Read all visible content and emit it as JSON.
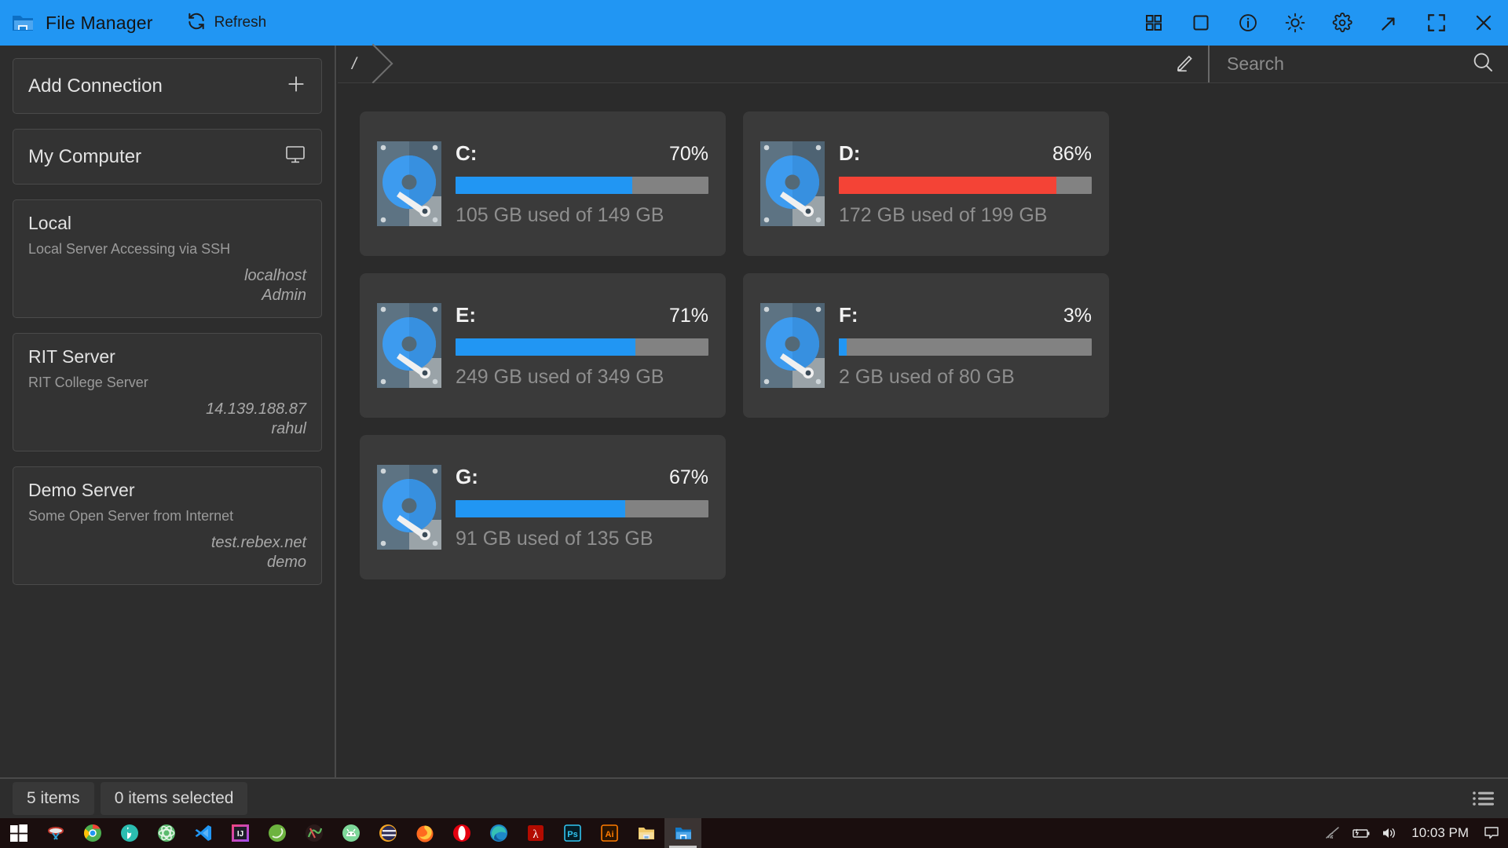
{
  "window": {
    "title": "File Manager",
    "app_icon": "folder-app-icon",
    "refresh_label": "Refresh",
    "accent_color": "#2196f3",
    "controls": [
      {
        "name": "grid-view-icon",
        "label": "Grid View"
      },
      {
        "name": "square-icon",
        "label": "Window"
      },
      {
        "name": "info-icon",
        "label": "Info"
      },
      {
        "name": "brightness-icon",
        "label": "Theme"
      },
      {
        "name": "gear-icon",
        "label": "Settings"
      },
      {
        "name": "minimize-icon",
        "label": "Restore Down"
      },
      {
        "name": "fullscreen-icon",
        "label": "Maximize"
      },
      {
        "name": "close-icon",
        "label": "Close"
      }
    ]
  },
  "sidebar": {
    "add_connection": {
      "label": "Add Connection",
      "icon": "plus-icon"
    },
    "my_computer": {
      "label": "My Computer",
      "icon": "monitor-icon"
    },
    "connections": [
      {
        "name": "Local",
        "description": "Local Server Accessing via SSH",
        "host": "localhost",
        "user": "Admin"
      },
      {
        "name": "RIT Server",
        "description": "RIT College Server",
        "host": "14.139.188.87",
        "user": "rahul"
      },
      {
        "name": "Demo Server",
        "description": "Some Open Server from Internet",
        "host": "test.rebex.net",
        "user": "demo"
      }
    ]
  },
  "pathbar": {
    "breadcrumbs": [
      "/"
    ],
    "edit_icon": "pencil-icon",
    "search": {
      "placeholder": "Search",
      "value": "",
      "icon": "search-icon"
    }
  },
  "drives": [
    {
      "letter": "C:",
      "percent": "70%",
      "fill": 70,
      "usage": "105 GB used of 149 GB",
      "color": "#2196f3",
      "icon": "hard-disk-icon"
    },
    {
      "letter": "D:",
      "percent": "86%",
      "fill": 86,
      "usage": "172 GB used of 199 GB",
      "color": "#f44336",
      "icon": "hard-disk-icon"
    },
    {
      "letter": "E:",
      "percent": "71%",
      "fill": 71,
      "usage": "249 GB used of 349 GB",
      "color": "#2196f3",
      "icon": "hard-disk-icon"
    },
    {
      "letter": "F:",
      "percent": "3%",
      "fill": 3,
      "usage": "2 GB used of 80 GB",
      "color": "#2196f3",
      "icon": "hard-disk-icon"
    },
    {
      "letter": "G:",
      "percent": "67%",
      "fill": 67,
      "usage": "91 GB used of 135 GB",
      "color": "#2196f3",
      "icon": "hard-disk-icon"
    }
  ],
  "statusbar": {
    "item_count": "5 items",
    "selection": "0 items selected",
    "view_toggle_icon": "list-view-icon"
  },
  "taskbar": {
    "start": {
      "name": "windows-start-icon",
      "label": "Start"
    },
    "apps": [
      {
        "name": "snipping-tool-icon",
        "label": "Snipping Tool"
      },
      {
        "name": "google-chrome-icon",
        "label": "Google Chrome"
      },
      {
        "name": "postman-icon",
        "label": "Postman"
      },
      {
        "name": "atom-icon",
        "label": "Atom"
      },
      {
        "name": "vs-code-icon",
        "label": "Visual Studio Code"
      },
      {
        "name": "intellij-idea-icon",
        "label": "IntelliJ IDEA"
      },
      {
        "name": "spring-tools-icon",
        "label": "Spring Tool Suite"
      },
      {
        "name": "gitkraken-icon",
        "label": "GitKraken"
      },
      {
        "name": "android-studio-icon",
        "label": "Android Studio"
      },
      {
        "name": "eclipse-icon",
        "label": "Eclipse"
      },
      {
        "name": "firefox-icon",
        "label": "Mozilla Firefox"
      },
      {
        "name": "opera-icon",
        "label": "Opera"
      },
      {
        "name": "microsoft-edge-icon",
        "label": "Microsoft Edge"
      },
      {
        "name": "acrobat-reader-icon",
        "label": "Adobe Acrobat Reader"
      },
      {
        "name": "photoshop-icon",
        "label": "Adobe Photoshop"
      },
      {
        "name": "illustrator-icon",
        "label": "Adobe Illustrator"
      },
      {
        "name": "file-folder-icon",
        "label": "File Explorer"
      },
      {
        "name": "file-manager-icon",
        "label": "File Manager",
        "active": true
      }
    ],
    "tray": {
      "wifi_icon": "wifi-icon",
      "battery_icon": "battery-charging-icon",
      "volume_icon": "volume-icon",
      "clock": "10:03 PM",
      "notifications_icon": "notification-icon"
    }
  }
}
